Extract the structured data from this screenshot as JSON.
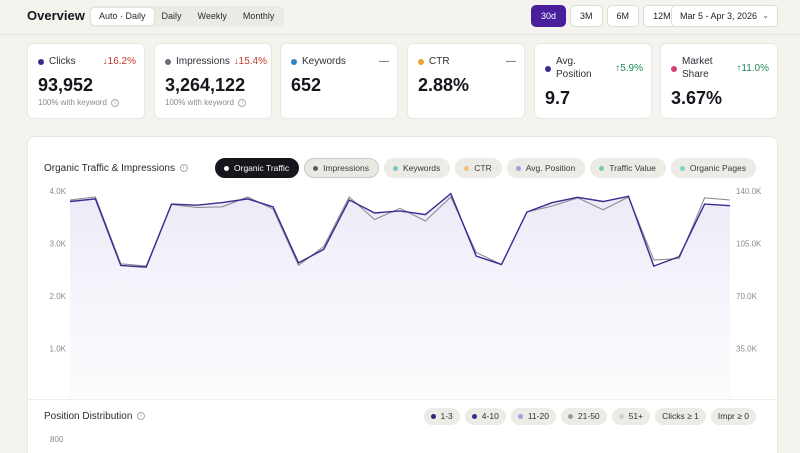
{
  "header": {
    "title": "Overview",
    "granularity": [
      "Auto · Daily",
      "Daily",
      "Weekly",
      "Monthly"
    ],
    "granularity_selected": "Auto · Daily",
    "ranges": [
      "30d",
      "3M",
      "6M",
      "12M"
    ],
    "range_selected": "30d",
    "date_range": "Mar 5 - Apr 3, 2026"
  },
  "kpis": [
    {
      "label": "Clicks",
      "delta": "16.2%",
      "direction": "down",
      "value": "93,952",
      "sub": "100% with keyword",
      "color": "#3b2a8f"
    },
    {
      "label": "Impressions",
      "delta": "15.4%",
      "direction": "down",
      "value": "3,264,122",
      "sub": "100% with keyword",
      "color": "#6a6a78"
    },
    {
      "label": "Keywords",
      "delta": "—",
      "direction": "flat",
      "value": "652",
      "sub": "",
      "color": "#2e86c1"
    },
    {
      "label": "CTR",
      "delta": "—",
      "direction": "flat",
      "value": "2.88%",
      "sub": "",
      "color": "#f0a030"
    },
    {
      "label": "Avg. Position",
      "delta": "5.9%",
      "direction": "up",
      "value": "9.7",
      "sub": "",
      "color": "#3b2a8f"
    },
    {
      "label": "Market Share",
      "delta": "11.0%",
      "direction": "up",
      "value": "3.67%",
      "sub": "",
      "color": "#d6407a"
    }
  ],
  "traffic_chart": {
    "title": "Organic Traffic & Impressions",
    "pills": [
      {
        "label": "Organic Traffic",
        "state": "active",
        "color": "#ffffff"
      },
      {
        "label": "Impressions",
        "state": "selected",
        "color": "#5b5b6b"
      },
      {
        "label": "Keywords",
        "state": "off",
        "color": "#7fc7c7"
      },
      {
        "label": "CTR",
        "state": "off",
        "color": "#f2c27a"
      },
      {
        "label": "Avg. Position",
        "state": "off",
        "color": "#a99be0"
      },
      {
        "label": "Traffic Value",
        "state": "off",
        "color": "#6fcf9e"
      },
      {
        "label": "Organic Pages",
        "state": "off",
        "color": "#7fd3d0"
      }
    ]
  },
  "chart_data": {
    "type": "line",
    "left_ticks": [
      "4.0K",
      "3.0K",
      "2.0K",
      "1.0K"
    ],
    "right_ticks": [
      "140.0K",
      "105.0K",
      "70.0K",
      "35.0K"
    ],
    "ylim_left": [
      0,
      4000
    ],
    "ylim_right": [
      0,
      140000
    ],
    "grid": false,
    "series": [
      {
        "axis": "left",
        "color": "#3b2a8f",
        "values": [
          3800,
          3850,
          2580,
          2550,
          3750,
          3730,
          3780,
          3850,
          3700,
          2630,
          2890,
          3830,
          3580,
          3620,
          3550,
          3950,
          2760,
          2600,
          3600,
          3780,
          3880,
          3800,
          3900,
          2570,
          2750,
          3750,
          3720
        ]
      },
      {
        "axis": "right",
        "color": "#8a8a94",
        "values": [
          134000,
          136000,
          91500,
          90000,
          131000,
          129000,
          129500,
          136000,
          128000,
          90500,
          103000,
          136000,
          121000,
          128500,
          120000,
          136000,
          99000,
          91000,
          126000,
          130000,
          135500,
          127500,
          136000,
          94000,
          95000,
          135500,
          134000
        ]
      }
    ]
  },
  "position_distribution": {
    "title": "Position Distribution",
    "pills": [
      {
        "label": "1-3",
        "color": "#2a2a7a"
      },
      {
        "label": "4-10",
        "color": "#3b2a8f"
      },
      {
        "label": "11-20",
        "color": "#a99be0"
      },
      {
        "label": "21-50",
        "color": "#9a9aa2"
      },
      {
        "label": "51+",
        "color": "#cfcfd4"
      },
      {
        "label": "Clicks ≥ 1",
        "color": ""
      },
      {
        "label": "Impr ≥ 0",
        "color": ""
      }
    ],
    "axis_top": "800"
  }
}
